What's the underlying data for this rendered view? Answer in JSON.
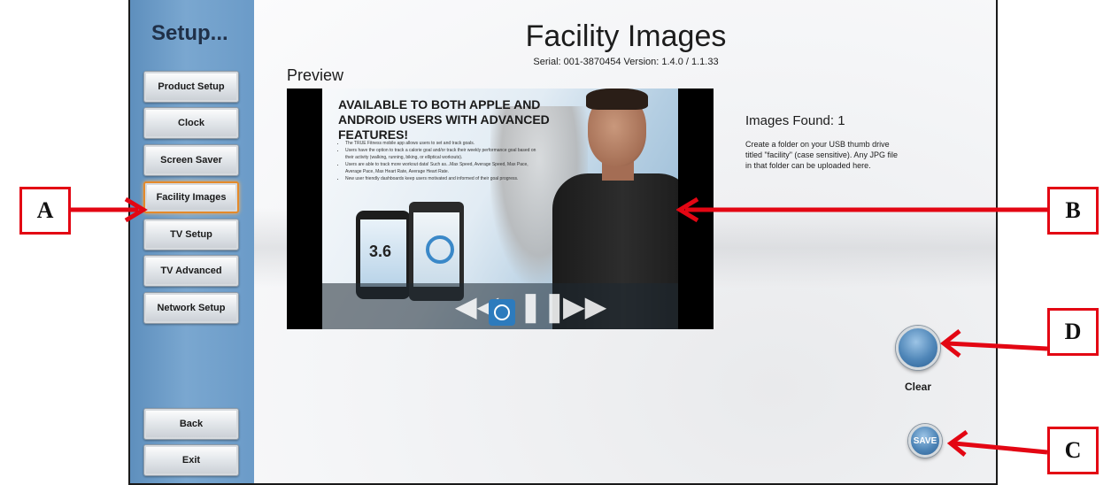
{
  "sidebar": {
    "title": "Setup...",
    "items": [
      {
        "label": "Product Setup"
      },
      {
        "label": "Clock"
      },
      {
        "label": "Screen Saver"
      },
      {
        "label": "Facility Images",
        "active": true
      },
      {
        "label": "TV Setup"
      },
      {
        "label": "TV Advanced"
      },
      {
        "label": "Network Setup"
      }
    ],
    "bottom": [
      {
        "label": "Back"
      },
      {
        "label": "Exit"
      }
    ]
  },
  "header": {
    "title": "Facility Images",
    "serial": "Serial: 001-3870454   Version: 1.4.0 / 1.1.33"
  },
  "preview": {
    "label": "Preview",
    "headline": "AVAILABLE TO BOTH APPLE AND ANDROID USERS WITH ADVANCED FEATURES!",
    "bullets": [
      "The TRUE Fitness mobile app allows users to set and track goals.",
      "Users have the option to track a calorie goal and/or track their weekly performance goal based on their activity (walking, running, biking, or elliptical workouts).",
      "Users are able to track more workout data! Such as...Max Speed, Average Speed, Max Pace, Average Pace, Max Heart Rate, Average Heart Rate.",
      "New user friendly dashboards keep users motivated and informed of their goal progress."
    ],
    "phone_value": "3.6"
  },
  "info": {
    "images_found": "Images Found: 1",
    "instructions": "Create a folder on your USB thumb drive titled \"facility\" (case sensitive). Any JPG file in that folder can be uploaded here."
  },
  "actions": {
    "clear_label": "Clear",
    "save_label": "SAVE"
  },
  "callouts": {
    "a": "A",
    "b": "B",
    "c": "C",
    "d": "D"
  },
  "colors": {
    "callout_red": "#e30613",
    "sidebar_blue": "#6b9bc8",
    "active_orange": "#e48a2a",
    "button_blue": "#4f86b8"
  }
}
